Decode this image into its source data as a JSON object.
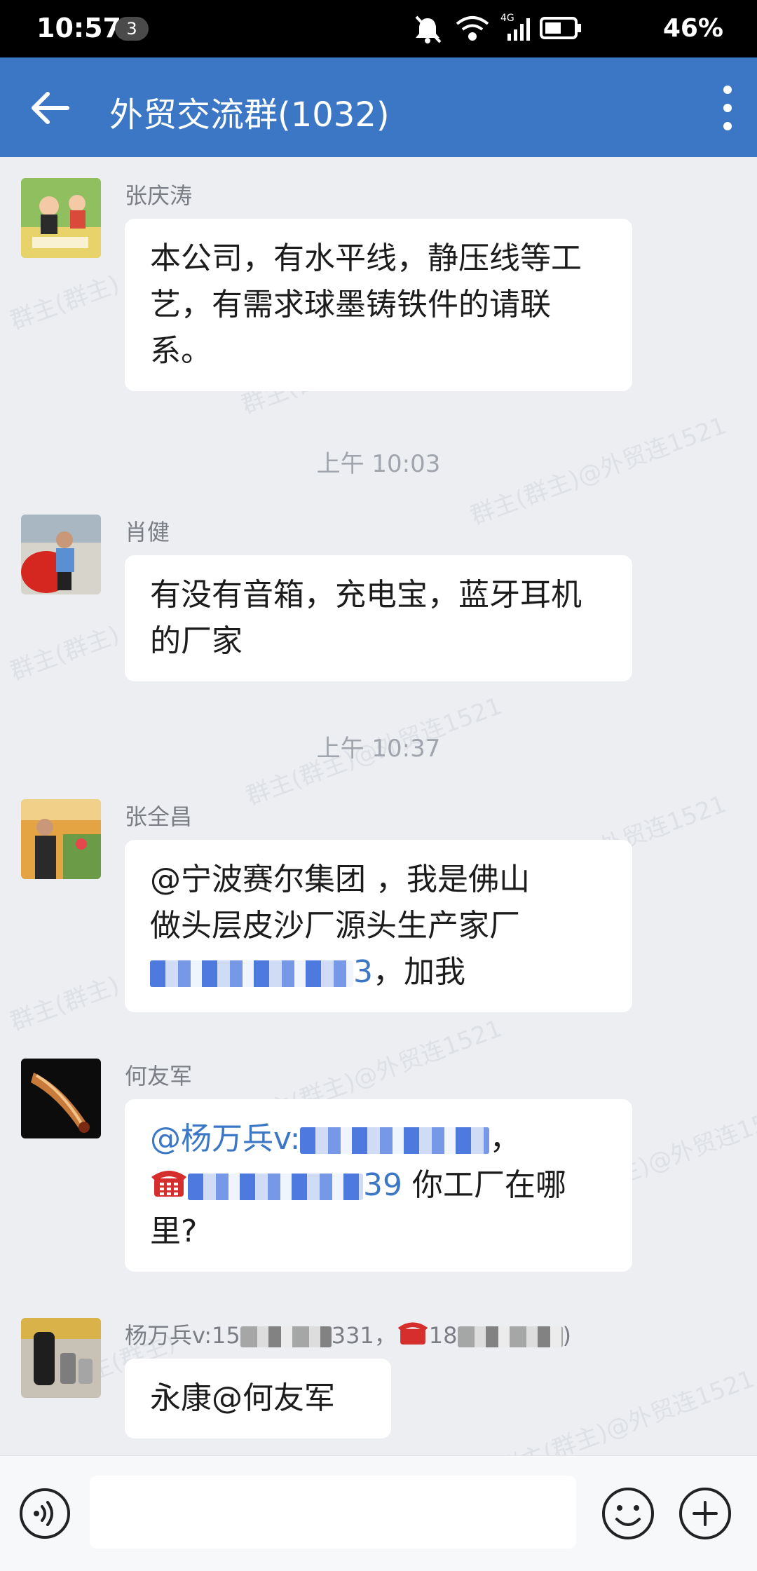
{
  "status_bar": {
    "time": "10:57",
    "notification_count": "3",
    "network": "4G",
    "battery": "46%"
  },
  "header": {
    "title": "外贸交流群(1032)",
    "back_icon": "arrow-left-icon",
    "menu_icon": "more-vertical-icon"
  },
  "watermark": {
    "text_a": "群主(群主)@外贸连1521",
    "text_b": "群主(群主)"
  },
  "messages": [
    {
      "sender": "张庆涛",
      "text": "本公司，有水平线，静压线等工艺，有需求球墨铸铁件的请联系。"
    },
    {
      "time": "上午 10:03"
    },
    {
      "sender": "肖健",
      "text": "有没有音箱，充电宝，蓝牙耳机的厂家"
    },
    {
      "time": "上午 10:37"
    },
    {
      "sender": "张全昌",
      "text_line1": "@宁波赛尔集团 ，我是佛山",
      "text_line2": "做头层皮沙厂源头生产家厂",
      "number_tail": "3",
      "text_tail": "，加我"
    },
    {
      "sender": "何友军",
      "mention": "@杨万兵v:",
      "comma": "，",
      "number_tail": "39",
      "text_tail": " 你工厂在哪",
      "text_line3": "里?"
    },
    {
      "sender_prefix": "杨万兵v:15",
      "sender_mid": "331，",
      "sender_tail": "18",
      "sender_end": ")",
      "text": "永康@何友军"
    }
  ],
  "input_bar": {
    "placeholder": "",
    "voice_icon": "voice-icon",
    "emoji_icon": "smile-icon",
    "plus_icon": "plus-circle-icon"
  },
  "colors": {
    "header_bg": "#3c77c6",
    "chat_bg": "#eceef2",
    "bubble_bg": "#ffffff",
    "link_blue": "#3c77c6"
  }
}
